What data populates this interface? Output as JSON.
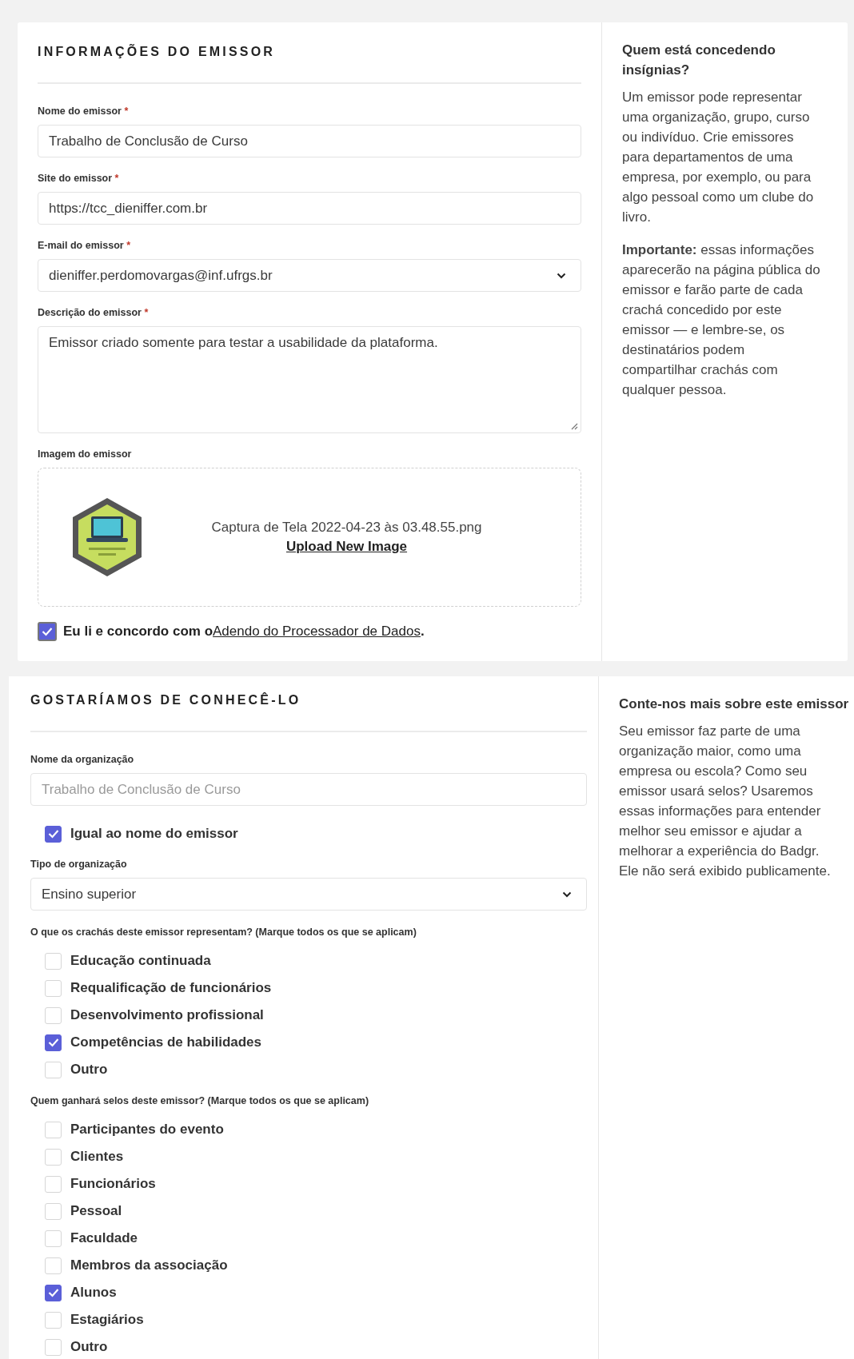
{
  "issuer_info": {
    "title": "INFORMAÇÕES DO EMISSOR",
    "fields": [
      {
        "kind": "text",
        "label": "Nome do emissor",
        "required_mark": "*",
        "value": "Trabalho de Conclusão de Curso"
      },
      {
        "kind": "text",
        "label": "Site do emissor",
        "required_mark": "*",
        "value": "https://tcc_dieniffer.com.br"
      },
      {
        "kind": "select",
        "label": "E-mail do emissor",
        "required_mark": "*",
        "value": "dieniffer.perdomovargas@inf.ufrgs.br"
      },
      {
        "kind": "textarea",
        "label": "Descrição do emissor",
        "required_mark": "*",
        "value": "Emissor criado somente para testar a usabilidade da plataforma."
      }
    ],
    "image": {
      "label": "Imagem do emissor",
      "filename": "Captura de Tela 2022-04-23 às 03.48.55.png",
      "upload_link": "Upload New Image"
    },
    "agreement": {
      "checked": true,
      "text": "Eu li e concordo com o",
      "link": "Adendo do Processador de Dados",
      "suffix": "."
    }
  },
  "issuer_help": {
    "title": "Quem está concedendo insígnias?",
    "paragraphs": [
      "Um emissor pode representar uma organização, grupo, curso ou indivíduo. Crie emissores para departamentos de uma empresa, por exemplo, ou para algo pessoal como um clube do livro.",
      "**Importante:** essas informações aparecerão na página pública do emissor e farão parte de cada crachá concedido por este emissor — e lembre-se, os destinatários podem compartilhar crachás com qualquer pessoa."
    ]
  },
  "about": {
    "title": "GOSTARÍAMOS DE CONHECÊ-LO",
    "org_name": {
      "label": "Nome da organização",
      "value": "Trabalho de Conclusão de Curso",
      "disabled": true
    },
    "same_as_issuer": {
      "label": "Igual ao nome do emissor",
      "checked": true
    },
    "org_type": {
      "label": "Tipo de organização",
      "value": "Ensino superior"
    },
    "groups": [
      {
        "question": "O que os crachás deste emissor representam? (Marque todos os que se aplicam)",
        "options": [
          {
            "label": "Educação continuada",
            "checked": false
          },
          {
            "label": "Requalificação de funcionários",
            "checked": false
          },
          {
            "label": "Desenvolvimento profissional",
            "checked": false
          },
          {
            "label": "Competências de habilidades",
            "checked": true
          },
          {
            "label": "Outro",
            "checked": false
          }
        ]
      },
      {
        "question": "Quem ganhará selos deste emissor? (Marque todos os que se aplicam)",
        "options": [
          {
            "label": "Participantes do evento",
            "checked": false
          },
          {
            "label": "Clientes",
            "checked": false
          },
          {
            "label": "Funcionários",
            "checked": false
          },
          {
            "label": "Pessoal",
            "checked": false
          },
          {
            "label": "Faculdade",
            "checked": false
          },
          {
            "label": "Membros da associação",
            "checked": false
          },
          {
            "label": "Alunos",
            "checked": true
          },
          {
            "label": "Estagiários",
            "checked": false
          },
          {
            "label": "Outro",
            "checked": false
          }
        ]
      }
    ]
  },
  "about_help": {
    "title": "Conte-nos mais sobre este emissor",
    "text": "Seu emissor faz parte de uma organização maior, como uma empresa ou escola? Como seu emissor usará selos? Usaremos essas informações para entender melhor seu emissor e ajudar a melhorar a experiência do Badgr. Ele não será exibido publicamente."
  }
}
